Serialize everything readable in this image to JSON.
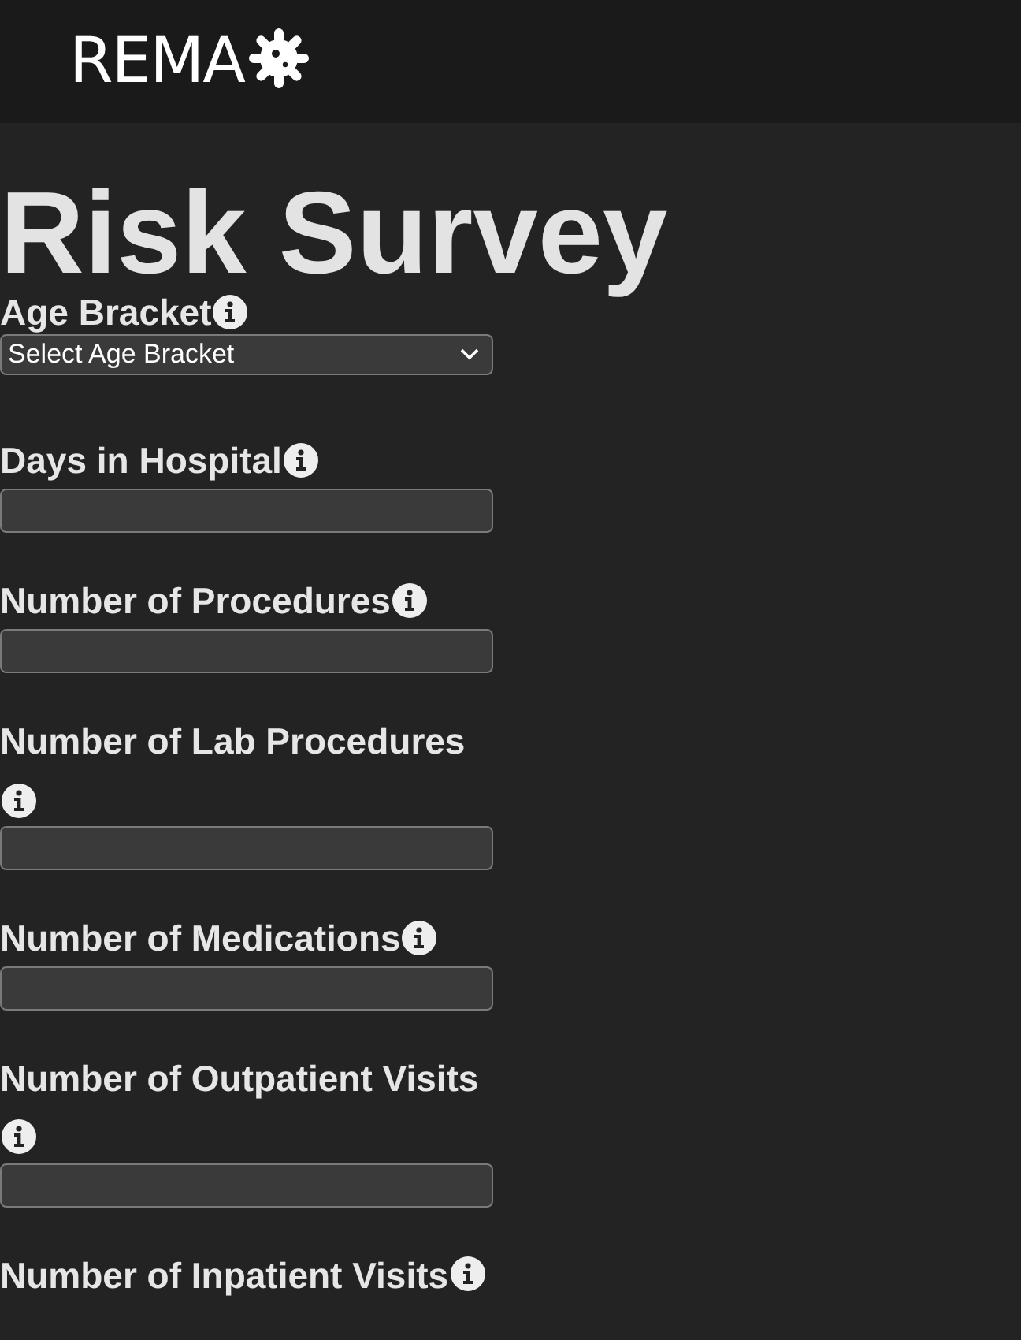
{
  "header": {
    "logo": "REMA"
  },
  "title": [
    "Risk Survey"
  ],
  "fields": [
    {
      "label": "Age Bracket",
      "kind": "select",
      "value": "Select Age Bracket"
    },
    {
      "label": "Days in Hospital",
      "kind": "text"
    },
    {
      "label": "Number of Procedures",
      "kind": "text"
    },
    {
      "label": "Number of Lab Procedures",
      "kind": "text"
    },
    {
      "label": "Number of Medications",
      "kind": "text"
    },
    {
      "label": "Number of Outpatient Visits",
      "kind": "text"
    },
    {
      "label": "Number of Inpatient Visits",
      "kind": "label"
    }
  ]
}
